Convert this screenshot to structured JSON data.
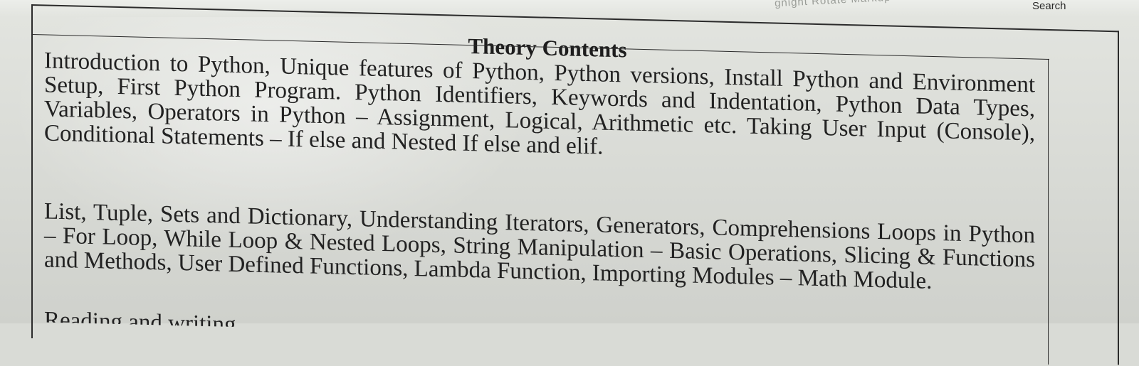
{
  "toolbar": {
    "faded_text": "gnight  Rotate  Markup",
    "search_label": "Search"
  },
  "document": {
    "title": "Theory Contents",
    "paragraphs": [
      "Introduction to Python, Unique features of Python, Python versions, Install Python and Environment Setup, First Python Program. Python Identifiers, Keywords and Indentation, Python Data Types, Variables, Operators in Python – Assignment, Logical, Arithmetic etc. Taking User Input (Console), Conditional Statements – If else and Nested If else and elif.",
      "List, Tuple, Sets and Dictionary, Understanding Iterators, Generators, Comprehensions Loops in Python – For Loop, While Loop & Nested Loops, String Manipulation – Basic Operations, Slicing & Functions and Methods, User Defined Functions, Lambda Function, Importing Modules – Math Module.",
      "Reading and writing"
    ]
  }
}
